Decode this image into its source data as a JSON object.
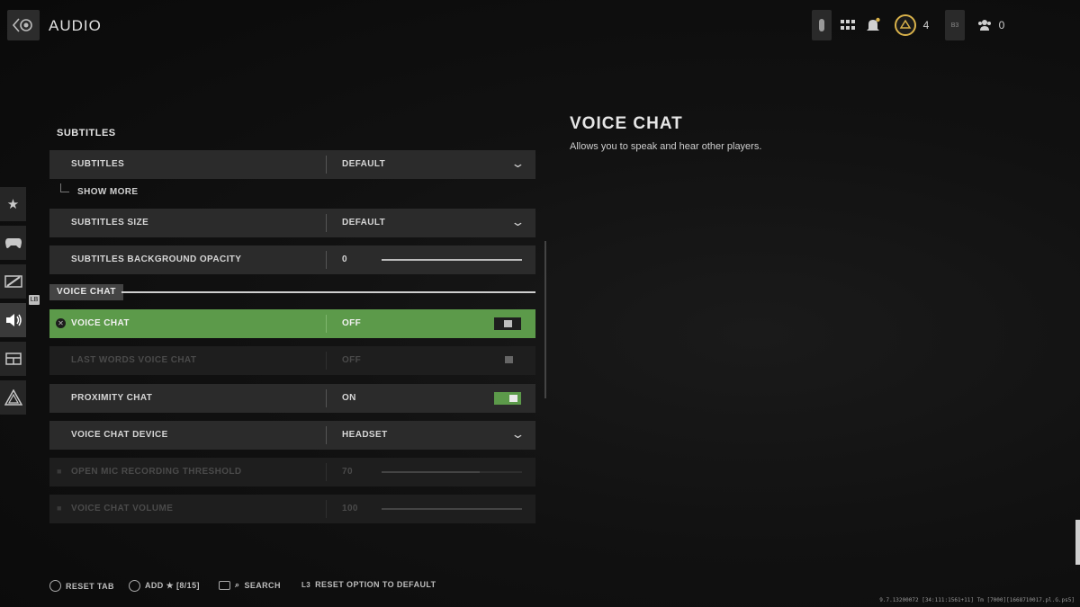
{
  "header": {
    "title": "AUDIO",
    "currency_count": "4",
    "friends_count": "0",
    "profile_badge": "B3"
  },
  "sidebar": {
    "items": [
      "favorites-icon",
      "controller-icon",
      "graphics-icon",
      "audio-icon",
      "interface-icon",
      "account-icon"
    ],
    "active": 3,
    "lb_hint": "LB"
  },
  "settings": {
    "section_subtitles": "SUBTITLES",
    "subtitles": {
      "label": "SUBTITLES",
      "value": "DEFAULT"
    },
    "show_more": "SHOW MORE",
    "subtitles_size": {
      "label": "SUBTITLES SIZE",
      "value": "DEFAULT"
    },
    "subtitles_bg_opacity": {
      "label": "SUBTITLES BACKGROUND OPACITY",
      "value": "0",
      "level": 1.0
    },
    "section_voice_chat": "VOICE CHAT",
    "voice_chat": {
      "label": "VOICE CHAT",
      "value": "OFF"
    },
    "last_words": {
      "label": "LAST WORDS VOICE CHAT",
      "value": "OFF"
    },
    "proximity_chat": {
      "label": "PROXIMITY CHAT",
      "value": "ON"
    },
    "voice_chat_device": {
      "label": "VOICE CHAT DEVICE",
      "value": "HEADSET"
    },
    "open_mic": {
      "label": "OPEN MIC RECORDING THRESHOLD",
      "value": "70",
      "level": 0.7
    },
    "voice_chat_volume": {
      "label": "VOICE CHAT VOLUME",
      "value": "100",
      "level": 1.0
    }
  },
  "detail": {
    "title": "VOICE CHAT",
    "description": "Allows you to speak and hear other players."
  },
  "footer": {
    "reset_tab": "RESET TAB",
    "add_favorite": "ADD ★ [8/15]",
    "search": "SEARCH",
    "reset_option": "RESET OPTION TO DEFAULT"
  },
  "build_info": "9.7.13200072 [34:111:1561+11] Tm [7000][1668710017.pl.G.ps5]",
  "colors": {
    "highlight": "#5c9a4a",
    "accent_gold": "#d9b24a"
  }
}
